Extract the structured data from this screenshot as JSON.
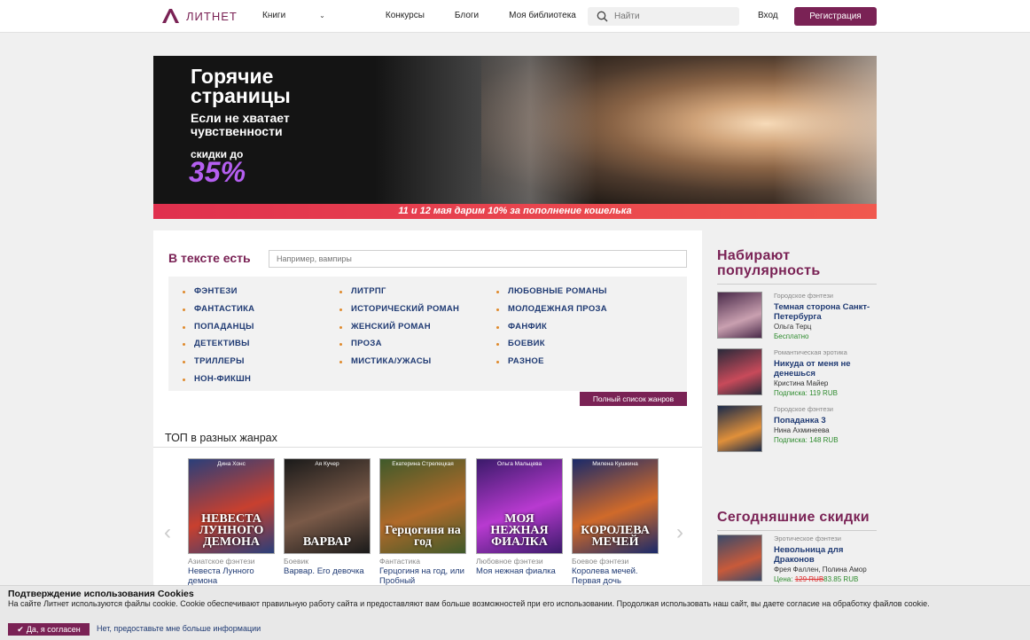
{
  "header": {
    "logo_text": "ЛИТНЕТ",
    "nav": [
      {
        "label": "Книги",
        "has_dropdown": true
      },
      {
        "label": "Конкурсы"
      },
      {
        "label": "Блоги"
      },
      {
        "label": "Моя библиотека"
      }
    ],
    "search_placeholder": "Найти",
    "login_label": "Вход",
    "register_label": "Регистрация",
    "accent_color": "#7a2255"
  },
  "banner": {
    "title": "Горячие страницы",
    "subtitle": "Если не хватает чувственности",
    "discount_label": "скидки до",
    "discount_value": "35%",
    "strip_text": "11 и 12 мая дарим 10% за пополнение кошелька"
  },
  "text_search": {
    "label": "В тексте есть",
    "placeholder": "Например, вампиры"
  },
  "genres": {
    "col1": [
      "ФЭНТЕЗИ",
      "ФАНТАСТИКА",
      "ПОПАДАНЦЫ",
      "ДЕТЕКТИВЫ",
      "ТРИЛЛЕРЫ",
      "НОН-ФИКШН"
    ],
    "col2": [
      "ЛИТРПГ",
      "ИСТОРИЧЕСКИЙ РОМАН",
      "ЖЕНСКИЙ РОМАН",
      "ПРОЗА",
      "МИСТИКА/УЖАСЫ"
    ],
    "col3": [
      "ЛЮБОВНЫЕ РОМАНЫ",
      "МОЛОДЕЖНАЯ ПРОЗА",
      "ФАНФИК",
      "БОЕВИК",
      "РАЗНОЕ"
    ],
    "full_list_label": "Полный список жанров"
  },
  "top": {
    "title": "ТОП в разных жанрах",
    "books": [
      {
        "genre": "Азиатское фэнтези",
        "title": "Невеста Лунного демона",
        "cover_title": "НЕВЕСТА ЛУННОГО ДЕМОНА",
        "cover_author": "Дина Хонс",
        "c1": "#2a3f7a",
        "c2": "#c8402f"
      },
      {
        "genre": "Боевик",
        "title": "Варвар. Его девочка",
        "cover_title": "ВАРВАР",
        "cover_author": "Ая Кучер",
        "c1": "#1a1a1a",
        "c2": "#7a5a48"
      },
      {
        "genre": "Фантастика",
        "title": "Герцогиня на год, или Пробный",
        "cover_title": "Герцогиня на год",
        "cover_author": "Екатерина Стрелецкая",
        "c1": "#3f5a2a",
        "c2": "#b06a2a"
      },
      {
        "genre": "Любовное фэнтези",
        "title": "Моя нежная фиалка",
        "cover_title": "МОЯ НЕЖНАЯ ФИАЛКА",
        "cover_author": "Ольга Мальцева",
        "c1": "#3a1a6a",
        "c2": "#b83ad0"
      },
      {
        "genre": "Боевое фэнтези",
        "title": "Королева мечей. Первая дочь",
        "cover_title": "КОРОЛЕВА МЕЧЕЙ",
        "cover_author": "Милена Кушкина",
        "c1": "#1a2a6a",
        "c2": "#d06a2a"
      }
    ]
  },
  "popular": {
    "title": "Набирают популярность",
    "books": [
      {
        "genre": "Городское фэнтези",
        "title": "Темная сторона Санкт-Петербурга",
        "author": "Ольга Терц",
        "price": "Бесплатно",
        "c1": "#4a2a4a",
        "c2": "#c9a0b0"
      },
      {
        "genre": "Романтическая эротика",
        "title": "Никуда от меня не денешься",
        "author": "Кристина Майер",
        "price": "Подписка: 119 RUB",
        "c1": "#2a2a3a",
        "c2": "#c84a5a"
      },
      {
        "genre": "Городское фэнтези",
        "title": "Попаданка 3",
        "author": "Нина Ахминеева",
        "price": "Подписка: 148 RUB",
        "c1": "#1a2a4a",
        "c2": "#e0903a"
      }
    ]
  },
  "discounts": {
    "title": "Сегодняшние скидки",
    "books": [
      {
        "genre": "Эротическое фэнтези",
        "title": "Невольница для Драконов",
        "author": "Фрея Фаллен, Полина Амор",
        "price_label": "Цена:",
        "old_price": "129 RUB",
        "new_price": "83.85 RUB",
        "c1": "#3a4a6a",
        "c2": "#c85a3a"
      }
    ]
  },
  "cookie": {
    "title": "Подтверждение использования Cookies",
    "text": "На сайте Литнет используются файлы cookie. Cookie обеспечивают правильную работу сайта и предоставляют вам больше возможностей при его использовании. Продолжая использовать наш сайт, вы даете согласие на обработку файлов cookie.",
    "accept_label": "Да, я согласен",
    "decline_label": "Нет, предоставьте мне больше информации"
  }
}
